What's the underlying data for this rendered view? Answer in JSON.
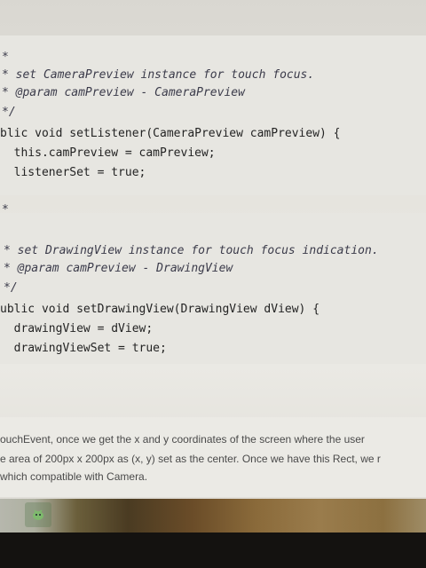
{
  "code": {
    "lines": [
      "*",
      "* set CameraPreview instance for touch focus.",
      "* @param camPreview - CameraPreview",
      "*/",
      "blic void setListener(CameraPreview camPreview) {",
      "  this.camPreview = camPreview;",
      "  listenerSet = true;",
      "*",
      "* set DrawingView instance for touch focus indication.",
      "* @param camPreview - DrawingView",
      "*/",
      "ublic void setDrawingView(DrawingView dView) {",
      "  drawingView = dView;",
      "  drawingViewSet = true;"
    ]
  },
  "prose": {
    "line1": "ouchEvent, once we get the x and y coordinates of the screen where the user",
    "line2": "e area of 200px x 200px as (x, y) set as the center. Once we have this Rect, we r",
    "line3": "which compatible with Camera."
  },
  "taskbar": {
    "icon": "android-studio-icon"
  }
}
